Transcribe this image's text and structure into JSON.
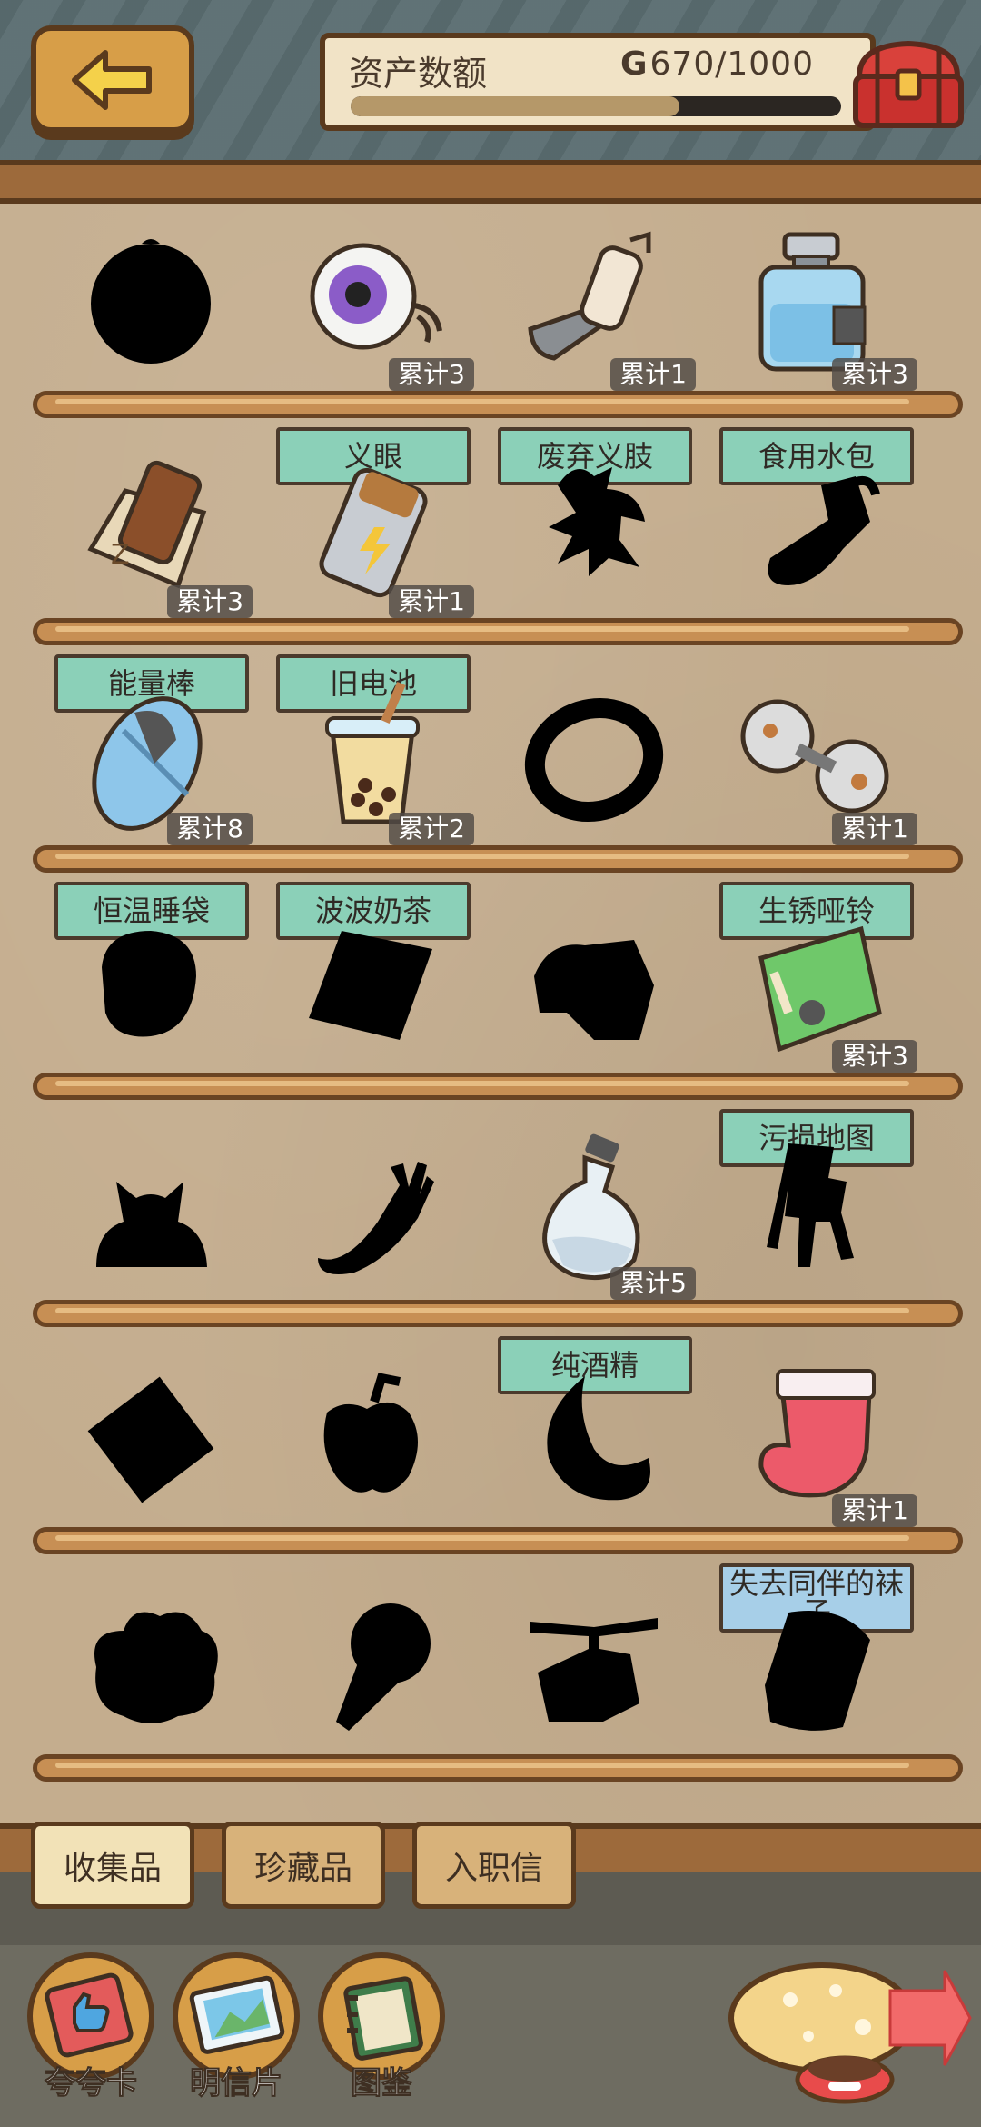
{
  "header": {
    "asset_label": "资产数额",
    "coin_symbol": "G",
    "asset_current": 670,
    "asset_max": 1000,
    "asset_text": "670/1000",
    "progress_fraction": 0.67
  },
  "items": [
    {
      "name": "",
      "count": "",
      "silhouette": true,
      "icon": "orb"
    },
    {
      "name": "义眼",
      "count": "累计3",
      "silhouette": false,
      "icon": "eyeball"
    },
    {
      "name": "废弃义肢",
      "count": "累计1",
      "silhouette": false,
      "icon": "prosthetic-arm"
    },
    {
      "name": "食用水包",
      "count": "累计3",
      "silhouette": false,
      "icon": "water-bottle"
    },
    {
      "name": "能量棒",
      "count": "累计3",
      "silhouette": false,
      "icon": "energy-bar"
    },
    {
      "name": "旧电池",
      "count": "累计1",
      "silhouette": false,
      "icon": "battery"
    },
    {
      "name": "",
      "count": "",
      "silhouette": true,
      "icon": "bird"
    },
    {
      "name": "",
      "count": "",
      "silhouette": true,
      "icon": "sock-shape"
    },
    {
      "name": "恒温睡袋",
      "count": "累计8",
      "silhouette": false,
      "icon": "sleeping-bag"
    },
    {
      "name": "波波奶茶",
      "count": "累计2",
      "silhouette": false,
      "icon": "bubble-tea"
    },
    {
      "name": "",
      "count": "",
      "silhouette": true,
      "icon": "ring"
    },
    {
      "name": "生锈哑铃",
      "count": "累计1",
      "silhouette": false,
      "icon": "dumbbell"
    },
    {
      "name": "",
      "count": "",
      "silhouette": true,
      "icon": "blob"
    },
    {
      "name": "",
      "count": "",
      "silhouette": true,
      "icon": "tile"
    },
    {
      "name": "",
      "count": "",
      "silhouette": true,
      "icon": "cloth"
    },
    {
      "name": "污损地图",
      "count": "累计3",
      "silhouette": false,
      "icon": "map"
    },
    {
      "name": "",
      "count": "",
      "silhouette": true,
      "icon": "cat"
    },
    {
      "name": "",
      "count": "",
      "silhouette": true,
      "icon": "fork"
    },
    {
      "name": "纯酒精",
      "count": "累计5",
      "silhouette": false,
      "icon": "alcohol-bottle"
    },
    {
      "name": "",
      "count": "",
      "silhouette": true,
      "icon": "robot"
    },
    {
      "name": "",
      "count": "",
      "silhouette": true,
      "icon": "diamond"
    },
    {
      "name": "",
      "count": "",
      "silhouette": true,
      "icon": "apple"
    },
    {
      "name": "",
      "count": "",
      "silhouette": true,
      "icon": "moon"
    },
    {
      "name": "失去同伴的袜子",
      "count": "累计1",
      "silhouette": false,
      "icon": "red-sock",
      "plate_style": "blue"
    },
    {
      "name": "",
      "count": "",
      "silhouette": true,
      "icon": "cloud"
    },
    {
      "name": "",
      "count": "",
      "silhouette": true,
      "icon": "ice-cream"
    },
    {
      "name": "",
      "count": "",
      "silhouette": true,
      "icon": "helicopter"
    },
    {
      "name": "",
      "count": "",
      "silhouette": true,
      "icon": "cup"
    }
  ],
  "tabs": [
    {
      "label": "收集品",
      "active": true
    },
    {
      "label": "珍藏品",
      "active": false
    },
    {
      "label": "入职信",
      "active": false
    }
  ],
  "bottom_buttons": [
    {
      "label": "夸夸卡",
      "icon": "thumbs-up-card-icon"
    },
    {
      "label": "明信片",
      "icon": "postcard-icon"
    },
    {
      "label": "图鉴",
      "icon": "book-icon"
    }
  ],
  "colors": {
    "name_plate": "#8bd0b8",
    "name_plate_alt": "#a7cfe8",
    "wood": "#c78f54",
    "outline": "#5a3a1d",
    "background": "#c4ad8e"
  }
}
